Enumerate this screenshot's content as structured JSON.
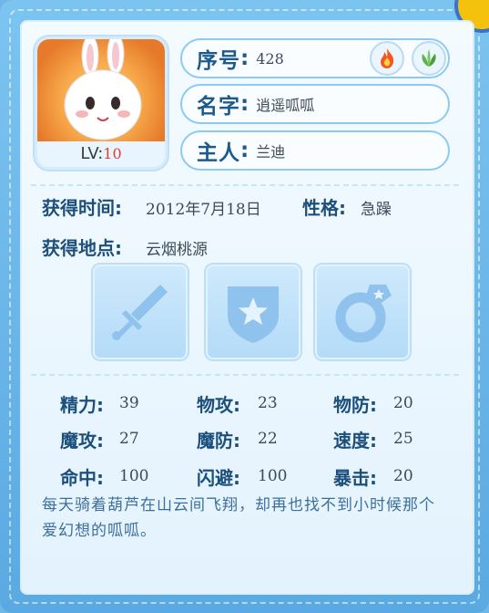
{
  "pet": {
    "level_label": "LV:",
    "level": "10",
    "elements": [
      "fire-icon",
      "leaf-icon"
    ]
  },
  "info": {
    "serial_label": "序号",
    "serial": "428",
    "name_label": "名字",
    "name": "逍遥呱呱",
    "owner_label": "主人",
    "owner": "兰迪"
  },
  "details": {
    "obtained_time_label": "获得时间",
    "obtained_time": "2012年7月18日",
    "personality_label": "性格",
    "personality": "急躁",
    "obtained_place_label": "获得地点",
    "obtained_place": "云烟桃源"
  },
  "equipment_slots": [
    "sword-icon",
    "shield-icon",
    "ring-icon"
  ],
  "stats": {
    "energy_label": "精力",
    "energy": "39",
    "phys_atk_label": "物攻",
    "phys_atk": "23",
    "phys_def_label": "物防",
    "phys_def": "20",
    "mag_atk_label": "魔攻",
    "mag_atk": "27",
    "mag_def_label": "魔防",
    "mag_def": "22",
    "speed_label": "速度",
    "speed": "25",
    "hit_label": "命中",
    "hit": "100",
    "dodge_label": "闪避",
    "dodge": "100",
    "crit_label": "暴击",
    "crit": "20"
  },
  "description": "每天骑着葫芦在山云间飞翔，却再也找不到小时候那个爱幻想的呱呱。",
  "colors": {
    "label": "#1c4f7c",
    "accent": "#e63c2e",
    "frame": "#6fb7e8"
  }
}
